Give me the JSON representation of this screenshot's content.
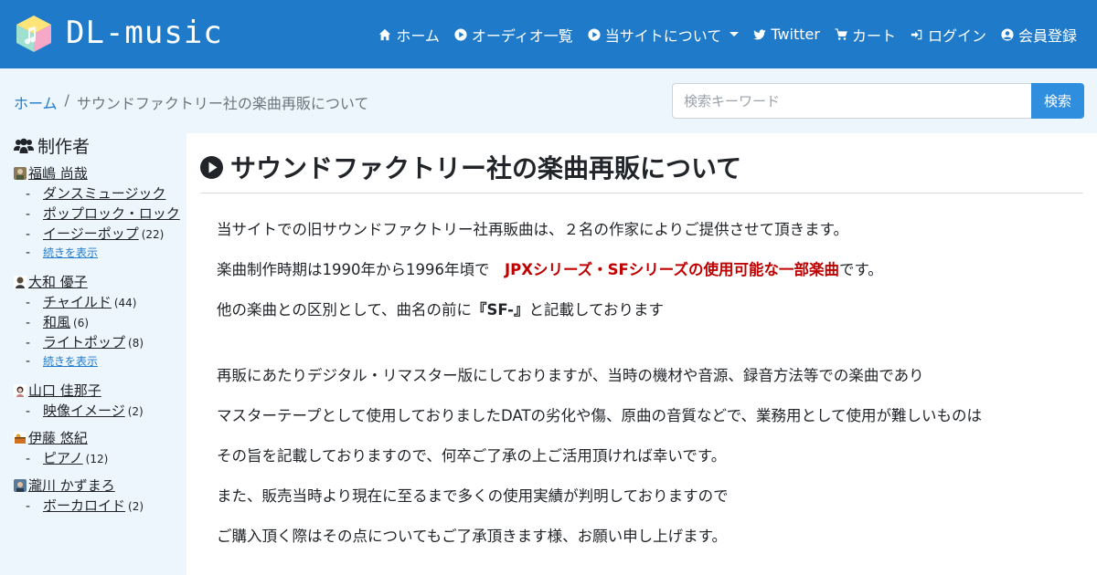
{
  "brand": {
    "name": "DL-music"
  },
  "nav": [
    {
      "label": "ホーム",
      "icon": "home-icon"
    },
    {
      "label": "オーディオ一覧",
      "icon": "play-circle-icon"
    },
    {
      "label": "当サイトについて",
      "icon": "play-circle-icon",
      "dropdown": true
    },
    {
      "label": "Twitter",
      "icon": "twitter-icon"
    },
    {
      "label": "カート",
      "icon": "cart-icon"
    },
    {
      "label": "ログイン",
      "icon": "sign-in-icon"
    },
    {
      "label": "会員登録",
      "icon": "user-circle-icon"
    }
  ],
  "breadcrumb": {
    "home": "ホーム",
    "separator": "/",
    "current": "サウンドファクトリー社の楽曲再販について"
  },
  "search": {
    "placeholder": "検索キーワード",
    "button": "検索"
  },
  "sidebar": {
    "heading": "制作者",
    "creators": [
      {
        "name": "福嶋 尚哉",
        "categories": [
          {
            "label": "ダンスミュージック",
            "count": ""
          },
          {
            "label": "ポップロック・ロック",
            "count": ""
          },
          {
            "label": "イージーポップ",
            "count": "(22)"
          },
          {
            "label": "続きを表示",
            "count": "",
            "more": true
          }
        ]
      },
      {
        "name": "大和 優子",
        "categories": [
          {
            "label": "チャイルド",
            "count": "(44)"
          },
          {
            "label": "和風",
            "count": "(6)"
          },
          {
            "label": "ライトポップ",
            "count": "(8)"
          },
          {
            "label": "続きを表示",
            "count": "",
            "more": true
          }
        ]
      },
      {
        "name": "山口 佳那子",
        "categories": [
          {
            "label": "映像イメージ",
            "count": "(2)"
          }
        ]
      },
      {
        "name": "伊藤 悠紀",
        "categories": [
          {
            "label": "ピアノ",
            "count": "(12)"
          }
        ]
      },
      {
        "name": "瀧川 かずまろ",
        "categories": [
          {
            "label": "ボーカロイド",
            "count": "(2)"
          }
        ]
      }
    ]
  },
  "main": {
    "title": "サウンドファクトリー社の楽曲再販について",
    "p1": "当サイトでの旧サウンドファクトリー社再販曲は、２名の作家によりご提供させて頂きます。",
    "p2_prefix": "楽曲制作時期は1990年から1996年頃で　",
    "p2_highlight": "JPXシリーズ・SFシリーズの使用可能な一部楽曲",
    "p2_suffix": "です。",
    "p3_prefix": "他の楽曲との区別として、曲名の前に",
    "p3_bold": "『SF-』",
    "p3_suffix": "と記載しております",
    "p4": "再販にあたりデジタル・リマスター版にしておりますが、当時の機材や音源、録音方法等での楽曲であり",
    "p5": "マスターテープとして使用しておりましたDATの劣化や傷、原曲の音質などで、業務用として使用が難しいものは",
    "p6": "その旨を記載しておりますので、何卒ご了承の上ご活用頂ければ幸いです。",
    "p7": "また、販売当時より現在に至るまで多くの使用実績が判明しておりますので",
    "p8": "ご購入頂く際はその点についてもご了承頂きます様、お願い申し上げます。"
  },
  "colors": {
    "navbar": "#1f7bc9",
    "accent": "#2f8fde",
    "highlight": "#c00000",
    "background": "#eef6fd"
  }
}
